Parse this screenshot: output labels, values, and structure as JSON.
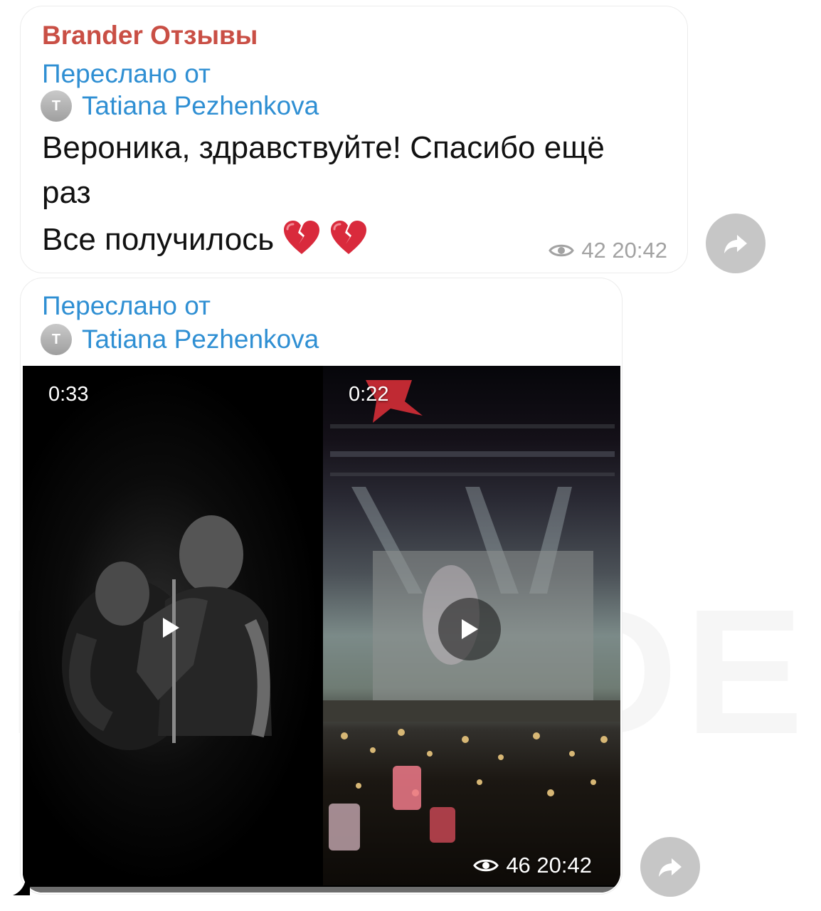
{
  "messages": [
    {
      "sender": "Brander Отзывы",
      "forward_label": "Переслано от",
      "forward_from": {
        "initial": "T",
        "name": "Tatiana Pezhenkova"
      },
      "text_lines": [
        "Вероника, здравствуйте! Спасибо ещё",
        "раз",
        "Все получилось"
      ],
      "emoji": [
        "broken-heart",
        "broken-heart"
      ],
      "views": "42",
      "time": "20:42"
    },
    {
      "forward_label": "Переслано от",
      "forward_from": {
        "initial": "T",
        "name": "Tatiana Pezhenkova"
      },
      "videos": [
        {
          "duration": "0:33",
          "description": "black-and-white concert photo"
        },
        {
          "duration": "0:22",
          "description": "concert stage crowd"
        }
      ],
      "views": "46",
      "time": "20:42"
    }
  ],
  "icons": {
    "views": "eye-icon",
    "share": "share-arrow-icon",
    "play": "play-icon",
    "emoji": "broken-heart-icon"
  },
  "watermark": "BRANDER",
  "colors": {
    "sender": "#c94f45",
    "link": "#2f8fd3",
    "meta": "#a2a2a2",
    "share_button": "#c6c6c6"
  }
}
